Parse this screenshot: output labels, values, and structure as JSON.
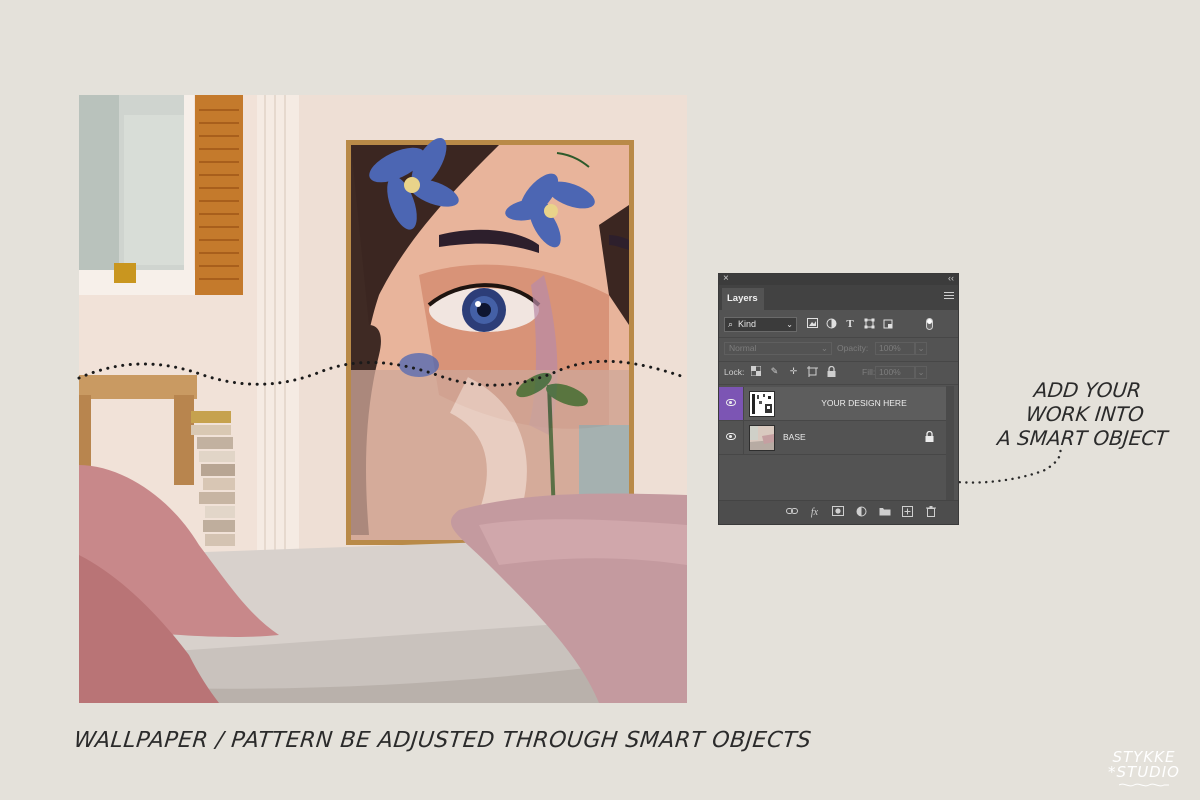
{
  "caption": "WALLPAPER / PATTERN BE ADJUSTED THROUGH SMART OBJECTS",
  "side_note": [
    "ADD YOUR",
    "WORK INTO",
    "A SMART OBJECT"
  ],
  "logo": [
    "STYKKE",
    "*STUDIO"
  ],
  "layers_panel": {
    "close_glyph": "×",
    "collapse_glyph": "‹‹",
    "tab_label": "Layers",
    "filter_select_value": "Kind",
    "blend_mode_value": "Normal",
    "opacity_label": "Opacity:",
    "opacity_value": "100%",
    "lock_label": "Lock:",
    "fill_label": "Fill:",
    "fill_value": "100%",
    "layers": [
      {
        "name": "YOUR DESIGN HERE",
        "selected": true,
        "visible": true,
        "locked": false
      },
      {
        "name": "BASE",
        "selected": false,
        "visible": true,
        "locked": true
      }
    ],
    "selection_color": "#7c55b4"
  },
  "colors": {
    "page_background": "#e4e1da",
    "panel_background": "#535353"
  },
  "icons": {
    "filter_icons": [
      "image-filter-icon",
      "adjustment-filter-icon",
      "type-filter-icon",
      "shape-filter-icon",
      "smart-object-filter-icon"
    ],
    "lock_icons": [
      "lock-transparent-pixels-icon",
      "lock-image-pixels-icon",
      "lock-position-icon",
      "lock-artboard-icon",
      "lock-all-icon"
    ],
    "bottom_icons": [
      "link-layers-icon",
      "layer-style-icon",
      "add-mask-icon",
      "new-adjustment-icon",
      "new-group-icon",
      "new-layer-icon",
      "delete-layer-icon"
    ]
  }
}
